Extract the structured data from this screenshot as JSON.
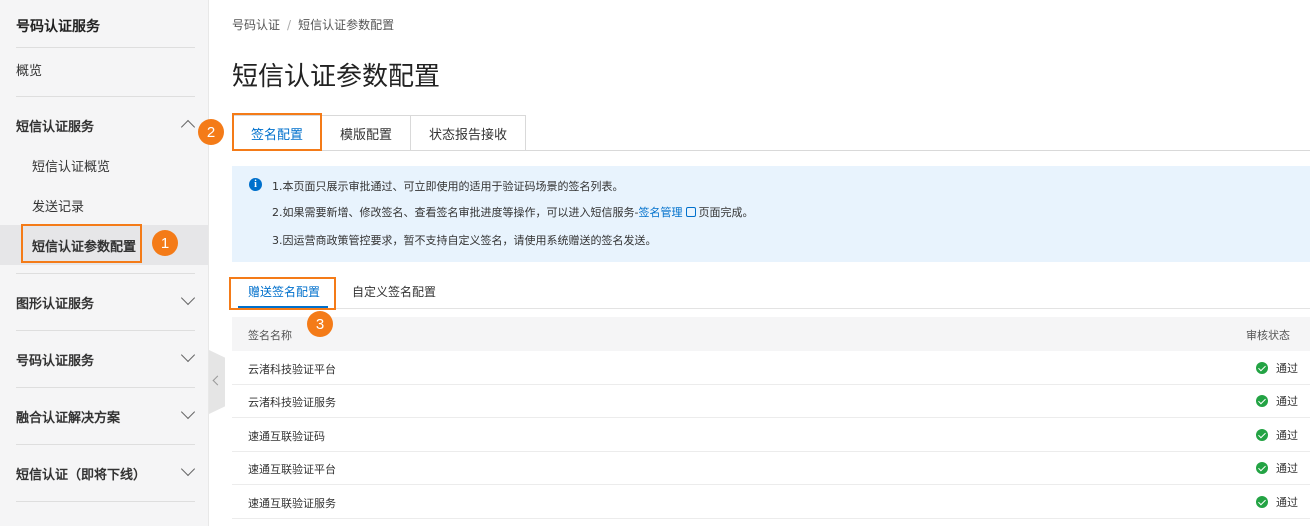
{
  "sidebar": {
    "title": "号码认证服务",
    "overview": "概览",
    "sms_group": "短信认证服务",
    "sms_overview": "短信认证概览",
    "send_records": "发送记录",
    "sms_param_config": "短信认证参数配置",
    "graphic_group": "图形认证服务",
    "number_group": "号码认证服务",
    "fusion_group": "融合认证解决方案",
    "sms_legacy_group": "短信认证（即将下线）"
  },
  "breadcrumb": {
    "root": "号码认证",
    "separator": "/",
    "current": "短信认证参数配置"
  },
  "page_title": "短信认证参数配置",
  "tabs": [
    "签名配置",
    "模版配置",
    "状态报告接收"
  ],
  "notice": {
    "line1": "1.本页面只展示审批通过、可立即使用的适用于验证码场景的签名列表。",
    "line2_prefix": "2.如果需要新增、修改签名、查看签名审批进度等操作，可以进入短信服务-",
    "line2_link": "签名管理",
    "line2_suffix": "页面完成。",
    "line3": "3.因运营商政策管控要求，暂不支持自定义签名，请使用系统赠送的签名发送。"
  },
  "subtabs": [
    "赠送签名配置",
    "自定义签名配置"
  ],
  "table": {
    "headers": {
      "name": "签名名称",
      "status": "审核状态"
    },
    "rows": [
      {
        "name": "云渚科技验证平台",
        "status": "通过"
      },
      {
        "name": "云渚科技验证服务",
        "status": "通过"
      },
      {
        "name": "速通互联验证码",
        "status": "通过"
      },
      {
        "name": "速通互联验证平台",
        "status": "通过"
      },
      {
        "name": "速通互联验证服务",
        "status": "通过"
      }
    ]
  },
  "annotations": {
    "badge1": "1",
    "badge2": "2",
    "badge3": "3",
    "color": "#f47b18"
  },
  "colors": {
    "link": "#0070cc",
    "success": "#23a344",
    "notice_bg": "#e8f3fd"
  }
}
